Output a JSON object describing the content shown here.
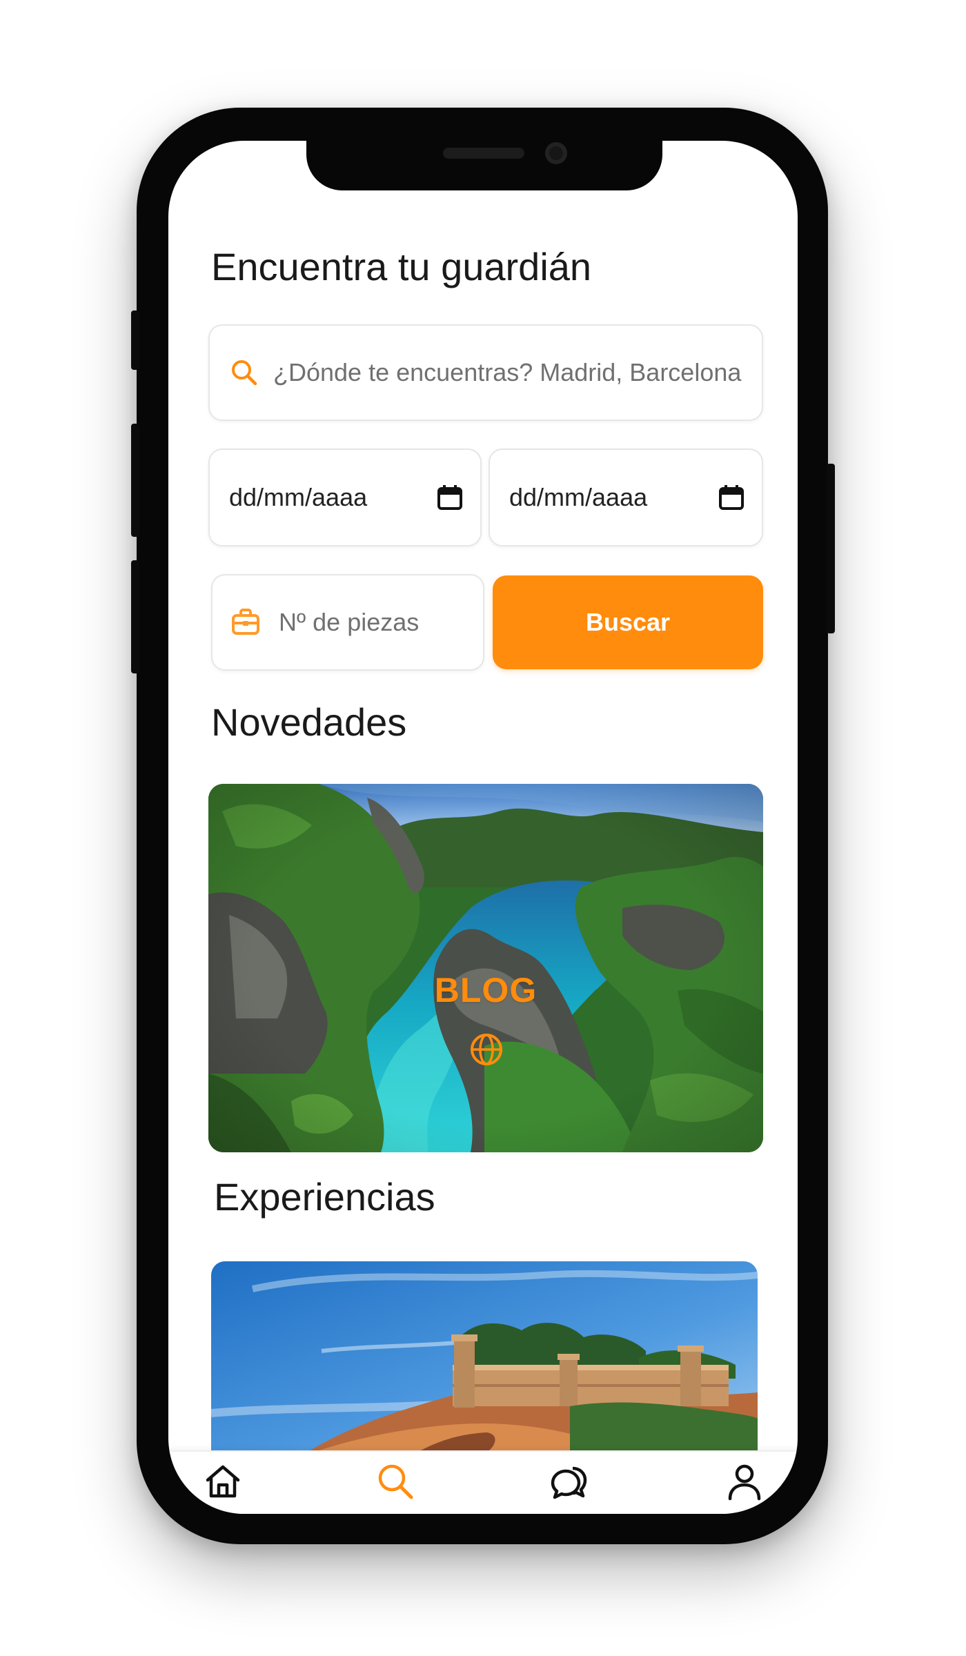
{
  "search_form": {
    "title": "Encuentra tu guardián",
    "location_placeholder": "¿Dónde te encuentras? Madrid, Barcelona",
    "start_date": "dd/mm/aaaa",
    "end_date": "dd/mm/aaaa",
    "pieces_placeholder": "Nº de piezas",
    "search_button": "Buscar"
  },
  "sections": {
    "novedades_title": "Novedades",
    "blog_label": "BLOG",
    "experiencias_title": "Experiencias"
  },
  "bottom_nav": {
    "items": [
      "home-icon",
      "search-icon",
      "chat-icon",
      "profile-icon"
    ],
    "active": "search-icon"
  },
  "colors": {
    "accent": "#ff8c0d",
    "text": "#1a1a1a",
    "placeholder": "#707070",
    "border": "#e6e6e6"
  }
}
